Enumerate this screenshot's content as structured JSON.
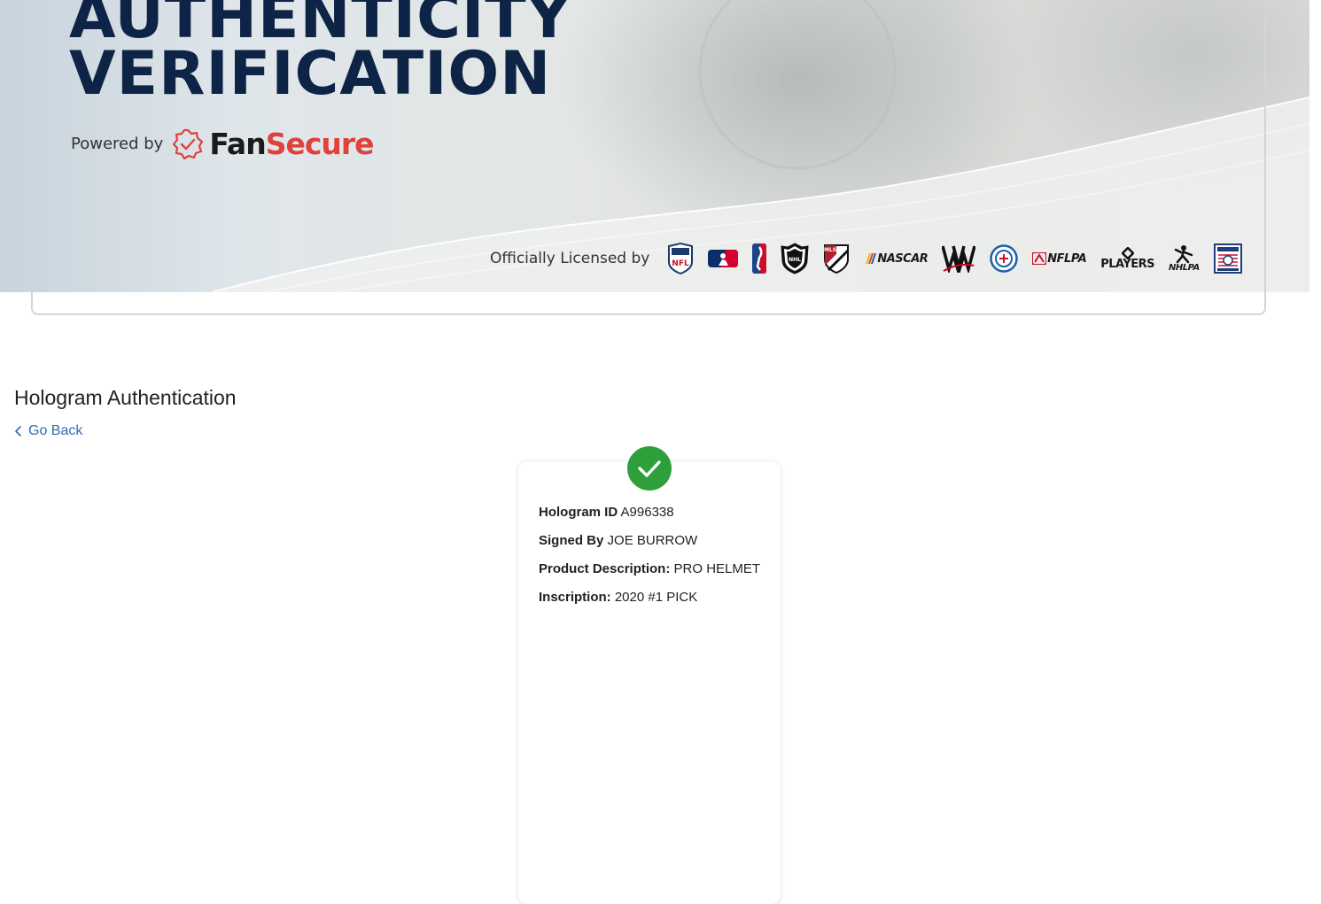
{
  "hero": {
    "title_line1": "AUTHENTICITY",
    "title_line2": "VERIFICATION",
    "powered_by": "Powered by",
    "brand_part1": "Fan",
    "brand_part2": "Secure",
    "licensed_by": "Officially Licensed by",
    "leagues": [
      "NFL",
      "MLB",
      "NBA",
      "NHL",
      "MLS",
      "NASCAR",
      "WWE",
      "MLBPA",
      "NFLPA",
      "PLAYERS",
      "NHLPA",
      "Hall of Fame"
    ],
    "wordmarks": {
      "nascar": "NASCAR",
      "nflpa": "NFLPA",
      "players": "PLAYERS",
      "nhlpa": "NHLPA"
    }
  },
  "page": {
    "title": "Hologram Authentication",
    "go_back": "Go Back"
  },
  "result": {
    "status_icon": "check-circle-icon",
    "hologram_id_label": "Hologram ID",
    "hologram_id": "A996338",
    "signed_by_label": "Signed By",
    "signed_by": "JOE BURROW",
    "product_label": "Product Description:",
    "product": "PRO HELMET",
    "inscription_label": "Inscription:",
    "inscription": "2020 #1 PICK"
  },
  "colors": {
    "title_navy": "#0e2446",
    "brand_red": "#e0413a",
    "success_green": "#2e9f3b",
    "link_blue": "#2f6db0"
  }
}
